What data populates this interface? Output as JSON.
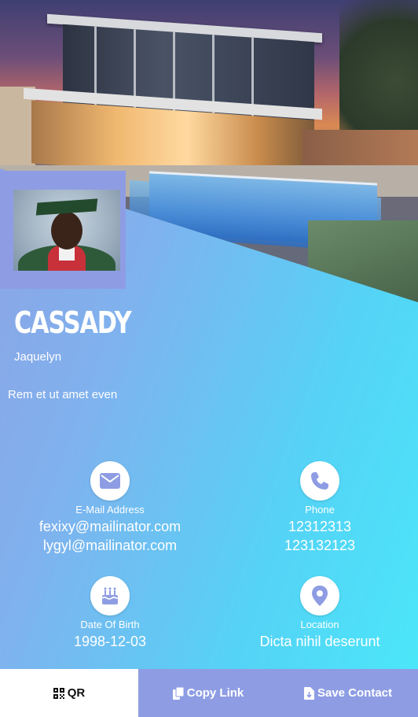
{
  "profile": {
    "name": "CASSADY",
    "subname": "Jaquelyn",
    "tagline": "Rem et ut amet even"
  },
  "contact": {
    "email": {
      "label": "E-Mail Address",
      "values": [
        "fexixy@mailinator.com",
        "lygyl@mailinator.com"
      ],
      "icon": "envelope-icon"
    },
    "phone": {
      "label": "Phone",
      "values": [
        "12312313",
        "123132123"
      ],
      "icon": "phone-icon"
    },
    "dob": {
      "label": "Date Of Birth",
      "value": "1998-12-03",
      "icon": "birthday-cake-icon"
    },
    "location": {
      "label": "Location",
      "value": "Dicta nihil deserunt",
      "icon": "map-pin-icon"
    }
  },
  "actions": {
    "qr": "QR",
    "copy": "Copy Link",
    "save": "Save Contact"
  },
  "colors": {
    "accent": "#8e9de3",
    "gradient_end": "#4ae8f9",
    "icon": "#8e9de3"
  }
}
